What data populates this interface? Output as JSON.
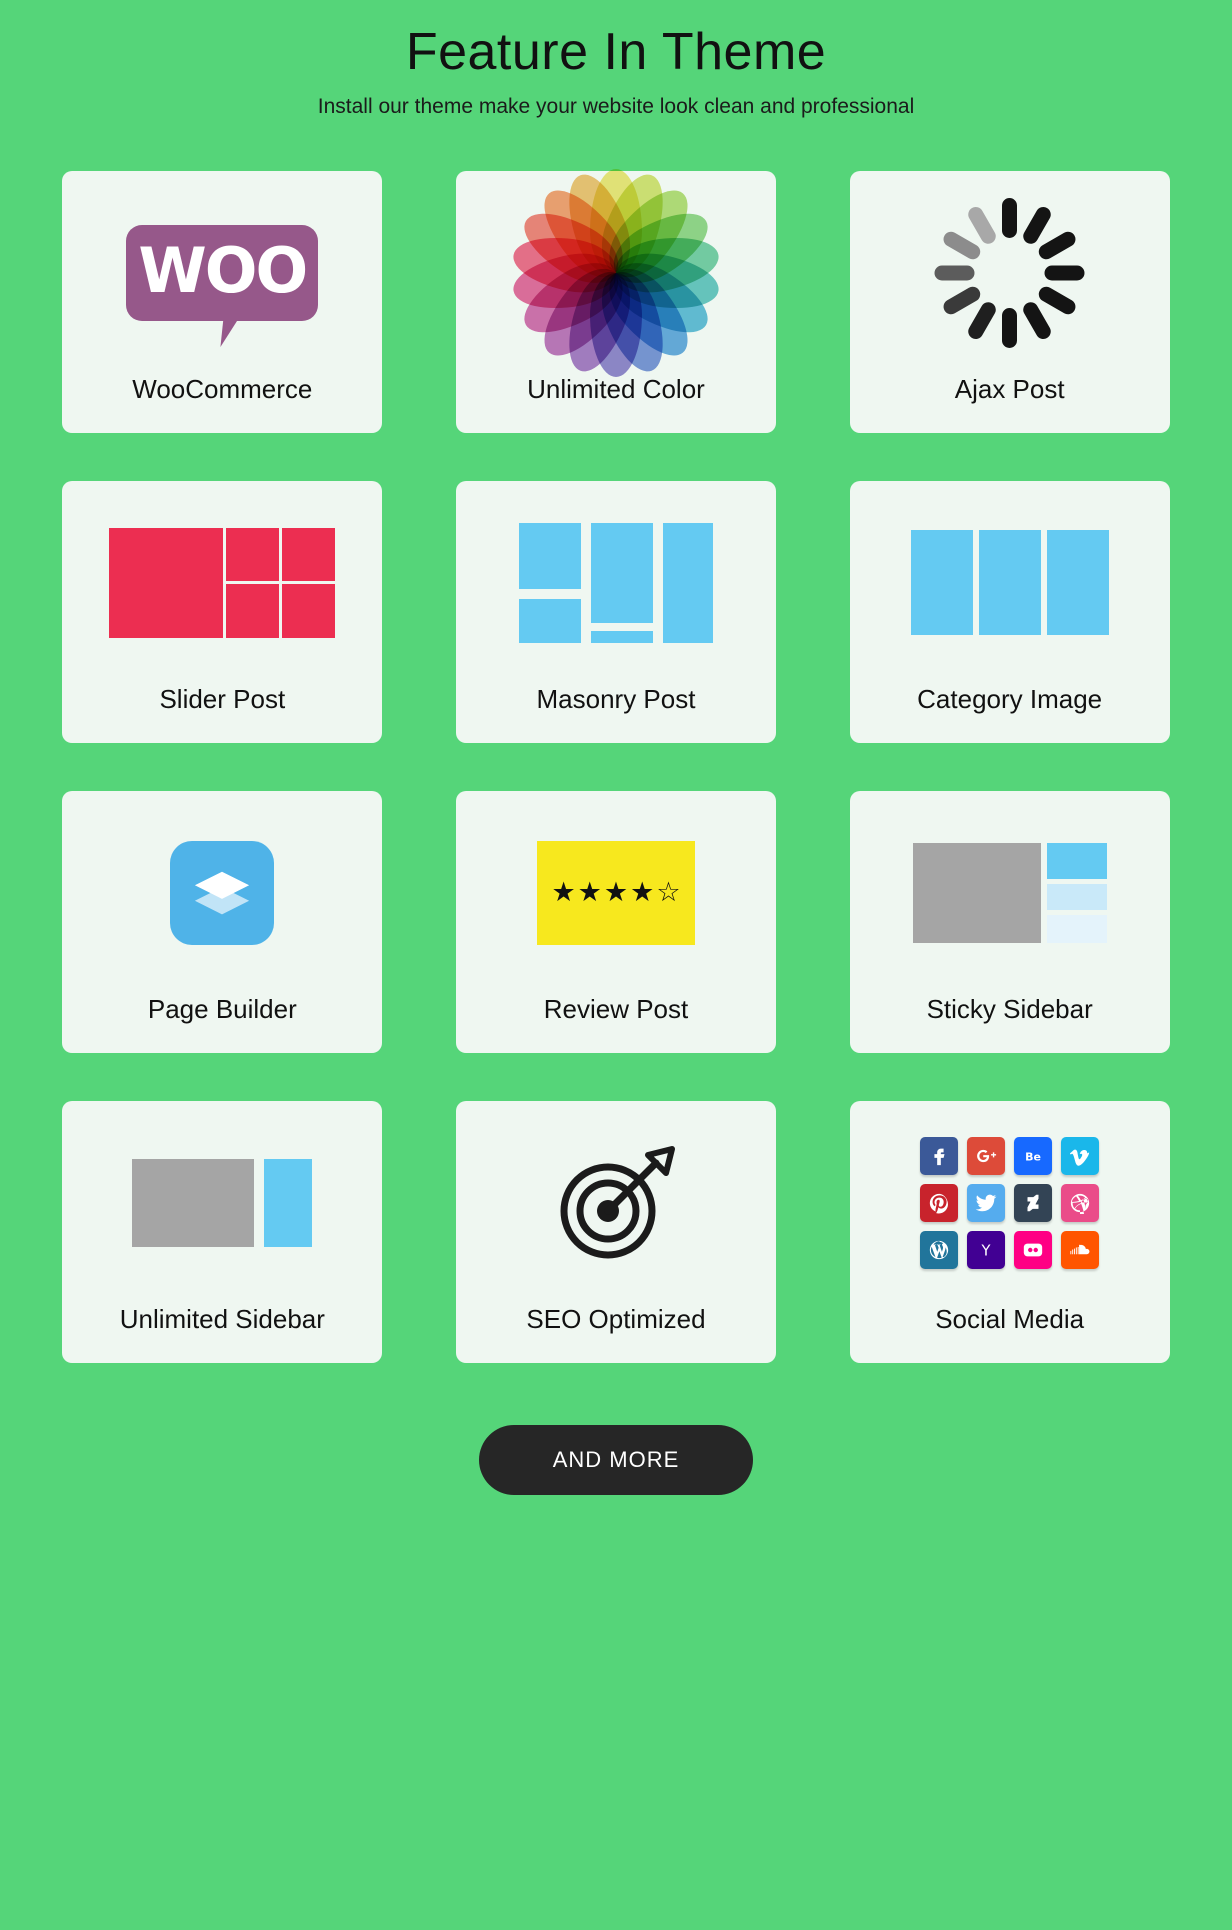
{
  "header": {
    "title": "Feature In Theme",
    "subtitle": "Install our theme make your website look clean and professional"
  },
  "colors": {
    "background": "#55d579",
    "card": "#eff7f1",
    "woo_purple": "#96588a",
    "slider_red": "#ec2e51",
    "block_blue": "#64caf2",
    "gray": "#a5a5a5",
    "review_yellow": "#f7e81e",
    "button_dark": "#262626",
    "text": "#111111"
  },
  "features": [
    {
      "id": "woocommerce",
      "label": "WooCommerce",
      "icon": "woo-logo-icon",
      "logo_text": "WOO"
    },
    {
      "id": "unlimited-color",
      "label": "Unlimited Color",
      "icon": "color-wheel-icon"
    },
    {
      "id": "ajax-post",
      "label": "Ajax Post",
      "icon": "loading-spinner-icon"
    },
    {
      "id": "slider-post",
      "label": "Slider Post",
      "icon": "slider-layout-icon"
    },
    {
      "id": "masonry-post",
      "label": "Masonry Post",
      "icon": "masonry-layout-icon"
    },
    {
      "id": "category-image",
      "label": "Category Image",
      "icon": "three-column-layout-icon"
    },
    {
      "id": "page-builder",
      "label": "Page Builder",
      "icon": "layers-stack-icon"
    },
    {
      "id": "review-post",
      "label": "Review Post",
      "icon": "star-rating-icon"
    },
    {
      "id": "sticky-sidebar",
      "label": "Sticky Sidebar",
      "icon": "sticky-sidebar-layout-icon"
    },
    {
      "id": "unlimited-sidebar",
      "label": "Unlimited Sidebar",
      "icon": "sidebar-layout-icon"
    },
    {
      "id": "seo-optimized",
      "label": "SEO Optimized",
      "icon": "target-dart-icon"
    },
    {
      "id": "social-media",
      "label": "Social Media",
      "icon": "social-icons-grid"
    }
  ],
  "review": {
    "filled_stars": 4,
    "total_stars": 5,
    "filled_glyph": "★",
    "empty_glyph": "☆"
  },
  "color_wheel": {
    "petal_count": 18,
    "colors": [
      "#e9e14a",
      "#c9dd45",
      "#9ed44a",
      "#6ecb62",
      "#46c08a",
      "#33b6b0",
      "#2aa7cf",
      "#2f8fd8",
      "#4a71cd",
      "#6a5cc0",
      "#8b4fb4",
      "#ab46a8",
      "#c83f96",
      "#e0397e",
      "#ee3c63",
      "#f15a4c",
      "#f4813f",
      "#edb042"
    ]
  },
  "spinner": {
    "spoke_count": 12,
    "colors": [
      "#141414",
      "#141414",
      "#141414",
      "#141414",
      "#141414",
      "#141414",
      "#141414",
      "#1f1f1f",
      "#3a3a3a",
      "#5c5c5c",
      "#8c8c8c",
      "#a8a8a8"
    ]
  },
  "social_icons": [
    {
      "name": "facebook",
      "glyph": "f",
      "bg": "#3b5998"
    },
    {
      "name": "google-plus",
      "glyph": "G+",
      "bg": "#dd4b39"
    },
    {
      "name": "behance",
      "glyph": "Be",
      "bg": "#1769ff"
    },
    {
      "name": "vimeo",
      "glyph": "v",
      "bg": "#1ab7ea"
    },
    {
      "name": "pinterest",
      "glyph": "P",
      "bg": "#c8232c"
    },
    {
      "name": "twitter",
      "glyph": "t",
      "bg": "#55acee"
    },
    {
      "name": "deviantart",
      "glyph": "d",
      "bg": "#334455"
    },
    {
      "name": "dribbble",
      "glyph": "o",
      "bg": "#ea4c89"
    },
    {
      "name": "wordpress",
      "glyph": "W",
      "bg": "#21759b"
    },
    {
      "name": "yahoo",
      "glyph": "Y",
      "bg": "#410093"
    },
    {
      "name": "flickr",
      "glyph": "..",
      "bg": "#ff0084"
    },
    {
      "name": "soundcloud",
      "glyph": "s",
      "bg": "#ff5500"
    }
  ],
  "footer": {
    "more_button": "AND MORE"
  }
}
